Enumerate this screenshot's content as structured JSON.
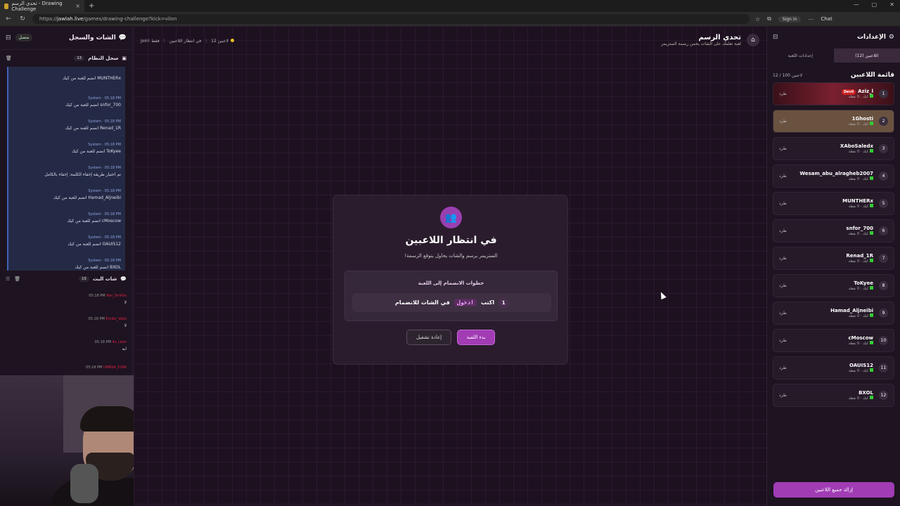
{
  "browser": {
    "tab_title": "تحدي الرسم - Drawing Challenge",
    "new_tab": "+",
    "url_host": "jawlah.live",
    "url_path": "/games/drawing-challenge?kick=vilon",
    "url_prefix": "https://",
    "signin": "Sign in",
    "chat": "Chat"
  },
  "left_panel": {
    "title": "الشات والسجل",
    "status": "متصل",
    "system_log": {
      "title": "سجل النظام",
      "count": "13",
      "messages": [
        {
          "meta": "",
          "text": "MUNTHERx انضم للعبة من كيك"
        },
        {
          "meta": "System · 05:18 PM",
          "text": "snfor_700 انضم للعبة من كيك"
        },
        {
          "meta": "System · 05:18 PM",
          "text": "Renad_1R انضم للعبة من كيك"
        },
        {
          "meta": "System · 05:18 PM",
          "text": "ToKyee انضم للعبة من كيك"
        },
        {
          "meta": "System · 05:18 PM",
          "text": "تم اختيار طريقة إخفاء الكلمة: إخفاء بالكامل"
        },
        {
          "meta": "System · 05:18 PM",
          "text": "Hamad_Aljneibi انضم للعبة من كيك"
        },
        {
          "meta": "System · 05:18 PM",
          "text": "cMoscow انضم للعبة من كيك"
        },
        {
          "meta": "System · 05:18 PM",
          "text": "OAUIS12 انضم للعبة من كيك"
        },
        {
          "meta": "System · 05:18 PM",
          "text": "BXOL انضم للعبة من كيك"
        }
      ]
    },
    "live_chat": {
      "title": "شات البث",
      "count": "15",
      "messages": [
        {
          "user": "Azo_Smiths",
          "time": "05:18 PM",
          "text": "لا"
        },
        {
          "user": "Emiko_Vabs",
          "time": "05:18 PM",
          "text": "لا"
        },
        {
          "user": "its_Leon",
          "time": "05:18 PM",
          "text": "ايه"
        },
        {
          "user": "UMRkA_5266",
          "time": "05:18 PM",
          "text": ""
        }
      ]
    }
  },
  "center": {
    "game_title": "تحدي الرسم",
    "game_subtitle": "لعبة تعلمك على الشات يخمن رسمة الستريمر",
    "players_count": "12 لاعبين",
    "state": "في انتظار اللاعبين",
    "join_hint": "join! فقط",
    "card": {
      "title": "في انتظار اللاعبين",
      "subtitle": "الستريمر يرسم والشات يحاول يتوقع الرسمة!",
      "steps_title": "خطوات الانضمام إلى اللعبة",
      "step_num": "1",
      "step_before": "اكتب",
      "step_keyword": "ادخول",
      "step_after": "في الشات للانضمام",
      "start_button": "بدء اللعبة",
      "restart_button": "إعادة تشغيل"
    }
  },
  "right_panel": {
    "title": "الإعدادات",
    "tabs": [
      "اللاعبين (12)",
      "إعدادات اللعبة"
    ],
    "list_title": "قائمة اللاعبين",
    "list_count": "12 / 100 لاعبين",
    "kick_label": "طرد",
    "players": [
      {
        "rank": "1",
        "name": "Aziz_l",
        "meta": "كيك · 0 نقطة",
        "badge": "Devil"
      },
      {
        "rank": "2",
        "name": "1Ghosti",
        "meta": "كيك · 0 نقطة",
        "badge": ""
      },
      {
        "rank": "3",
        "name": "XAboSaledx",
        "meta": "كيك · 0 نقطة",
        "badge": ""
      },
      {
        "rank": "4",
        "name": "Wesam_abu_alragheb2007",
        "meta": "كيك · 0 نقطة",
        "badge": ""
      },
      {
        "rank": "5",
        "name": "MUNTHERx",
        "meta": "كيك · 0 نقطة",
        "badge": ""
      },
      {
        "rank": "6",
        "name": "snfor_700",
        "meta": "كيك · 0 نقطة",
        "badge": ""
      },
      {
        "rank": "7",
        "name": "Renad_1R",
        "meta": "كيك · 0 نقطة",
        "badge": ""
      },
      {
        "rank": "8",
        "name": "ToKyee",
        "meta": "كيك · 0 نقطة",
        "badge": ""
      },
      {
        "rank": "9",
        "name": "Hamad_Aljneibi",
        "meta": "كيك · 0 نقطة",
        "badge": ""
      },
      {
        "rank": "10",
        "name": "cMoscow",
        "meta": "كيك · 0 نقطة",
        "badge": ""
      },
      {
        "rank": "11",
        "name": "OAUIS12",
        "meta": "كيك · 0 نقطة",
        "badge": ""
      },
      {
        "rank": "12",
        "name": "BXOL",
        "meta": "كيك · 0 نقطة",
        "badge": ""
      }
    ],
    "remove_all": "إزالة جميع اللاعبين"
  },
  "colors": {
    "accent": "#a13cb4",
    "system_border": "#3e63b8",
    "background": "#1d1120"
  }
}
